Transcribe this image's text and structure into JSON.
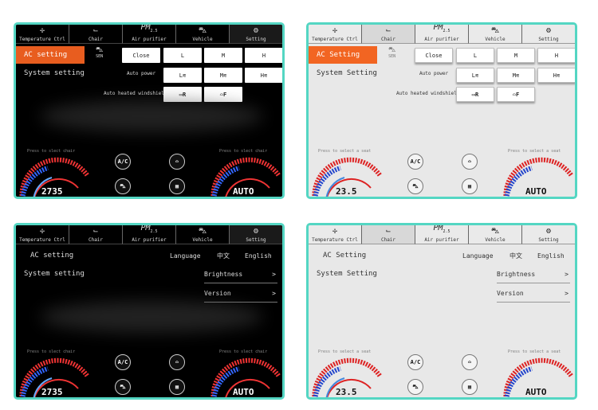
{
  "tabs": [
    {
      "label": "Temperature Ctrl",
      "icon": "fan-icon",
      "glyph": "✢"
    },
    {
      "label": "Chair",
      "icon": "chair-icon",
      "glyph": "⌙"
    },
    {
      "label": "Air purifier",
      "icon": "pm-icon",
      "glyph": "PM"
    },
    {
      "label": "Vehicle",
      "icon": "car-icon",
      "glyph": "⛍"
    },
    {
      "label": "Setting",
      "icon": "gear-icon",
      "glyph": "⚙"
    }
  ],
  "pm_sub": "2.5",
  "ac_setting_upper": "AC setting",
  "ac_setting_light": "AC Setting",
  "system_setting_dark": "System setting",
  "system_setting_light": "System Setting",
  "sen_label": "SEN",
  "close_label": "Close",
  "level_low": "L",
  "level_mid": "M",
  "level_high": "H",
  "auto_power_label": "Auto power",
  "auto_heated_label": "Auto heated windshield",
  "rear_defrost_label": "R",
  "front_defrost_label": "F",
  "press_dark": "Press to slect chair",
  "press_light": "Press to select a seat",
  "ac_button": "A/C",
  "left_value_dark": "2735",
  "right_value_dark": "AUTO",
  "left_value_light": "23.5",
  "right_value_light": "AUTO",
  "language_label": "Language",
  "lang_zh": "中文",
  "lang_en": "English",
  "brightness_label": "Brightness",
  "version_label": "Version",
  "arrow": ">"
}
